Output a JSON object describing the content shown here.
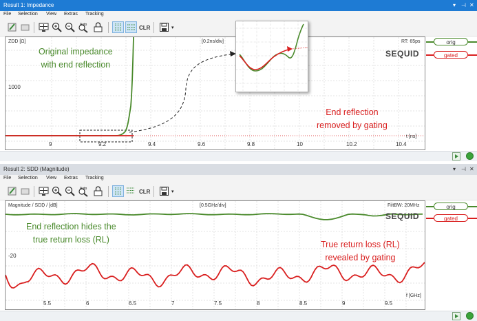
{
  "colors": {
    "orig": "#4a8a2c",
    "gated": "#d91e1e",
    "titlebar_active": "#1e7bd4"
  },
  "menu": [
    "File",
    "Selection",
    "View",
    "Extras",
    "Tracking"
  ],
  "toolbar_icons": [
    "edit-icon",
    "eraser-icon",
    "screen-icon",
    "zoom-in-icon",
    "zoom-out-icon",
    "auto-zoom-icon",
    "lock-icon",
    "vertical-grid-icon",
    "horizontal-grid-icon",
    "clear-icon",
    "save-icon"
  ],
  "toolbar": {
    "auto_label": "Auto",
    "clr_label": "CLR"
  },
  "panel1": {
    "title": "Result 1: Impedance",
    "y_label": "ZDD [Ω]",
    "scale_label": "[0.2ns/div]",
    "rt_label": "RT: 65ps",
    "y_tick": "1000",
    "x_ticks": [
      "9",
      "9.2",
      "9.4",
      "9.6",
      "9.8",
      "10",
      "10.2",
      "10.4"
    ],
    "x_unit": "t [ns]",
    "annot_orig": [
      "Original impedance",
      "with end reflection"
    ],
    "annot_gated": [
      "End reflection",
      "removed by gating"
    ]
  },
  "panel2": {
    "title": "Result 2: SDD (Magnitude)",
    "y_label": "Magnitude / SDD / [dB]",
    "scale_label": "[0.5GHz/div]",
    "filt_label": "FiltBW: 20MHz",
    "y_tick": "-20",
    "x_ticks": [
      "5.5",
      "6",
      "6.5",
      "7",
      "7.5",
      "8",
      "8.5",
      "9",
      "9.5"
    ],
    "x_unit": "f [GHz]",
    "annot_orig": [
      "End reflection hides the",
      "true return loss (RL)"
    ],
    "annot_gated": [
      "True return loss (RL)",
      "revealed by gating"
    ]
  },
  "legend": {
    "orig": "orig",
    "gated": "gated"
  },
  "logo": "SEQUID"
}
